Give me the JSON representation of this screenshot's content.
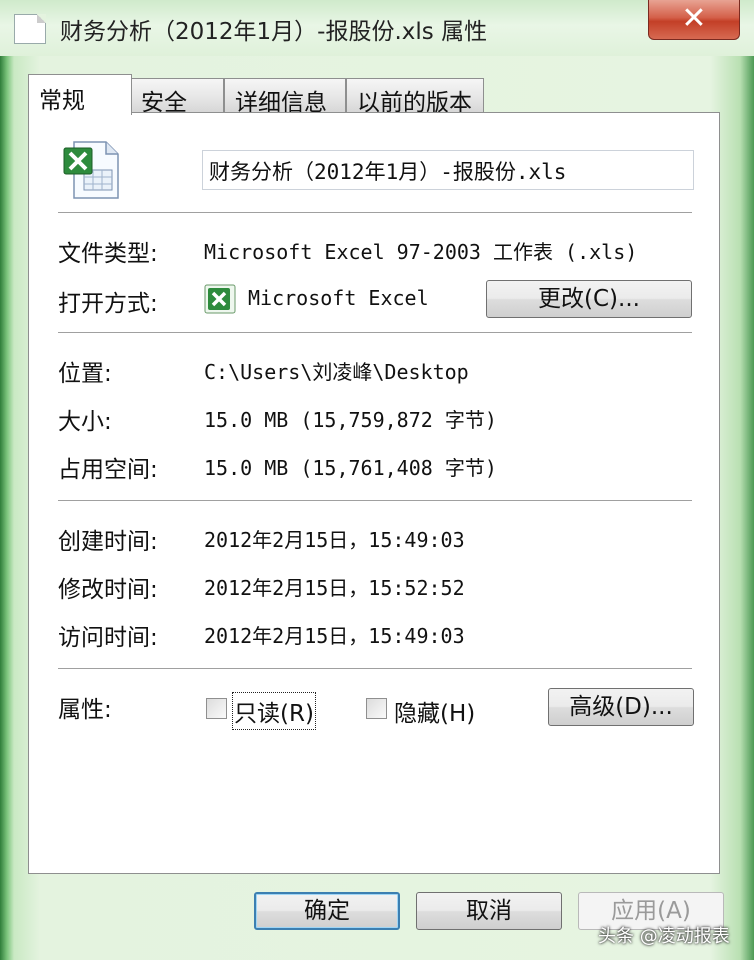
{
  "window": {
    "title": "财务分析（2012年1月）-报股份.xls 属性",
    "close_label": "✕"
  },
  "tabs": [
    {
      "label": "常规"
    },
    {
      "label": "安全"
    },
    {
      "label": "详细信息"
    },
    {
      "label": "以前的版本"
    }
  ],
  "general": {
    "filename": "财务分析（2012年1月）-报股份.xls",
    "file_type_label": "文件类型:",
    "file_type_value": "Microsoft Excel 97-2003 工作表 (.xls)",
    "open_with_label": "打开方式:",
    "open_with_value": "Microsoft Excel",
    "change_button": "更改(C)...",
    "location_label": "位置:",
    "location_value": "C:\\Users\\刘凌峰\\Desktop",
    "size_label": "大小:",
    "size_value": "15.0 MB (15,759,872 字节)",
    "disk_size_label": "占用空间:",
    "disk_size_value": "15.0 MB (15,761,408 字节)",
    "created_label": "创建时间:",
    "created_value": "2012年2月15日，15:49:03",
    "modified_label": "修改时间:",
    "modified_value": "2012年2月15日，15:52:52",
    "accessed_label": "访问时间:",
    "accessed_value": "2012年2月15日，15:49:03",
    "attributes_label": "属性:",
    "readonly_label": "只读(R)",
    "hidden_label": "隐藏(H)",
    "advanced_button": "高级(D)..."
  },
  "footer": {
    "ok_button": "确定",
    "cancel_button": "取消",
    "apply_button": "应用(A)"
  },
  "watermark": "头条 @凌动报表",
  "colors": {
    "window_frame": "#7cc47c",
    "close_button": "#c33f27",
    "default_button_border": "#3c7fb1"
  }
}
